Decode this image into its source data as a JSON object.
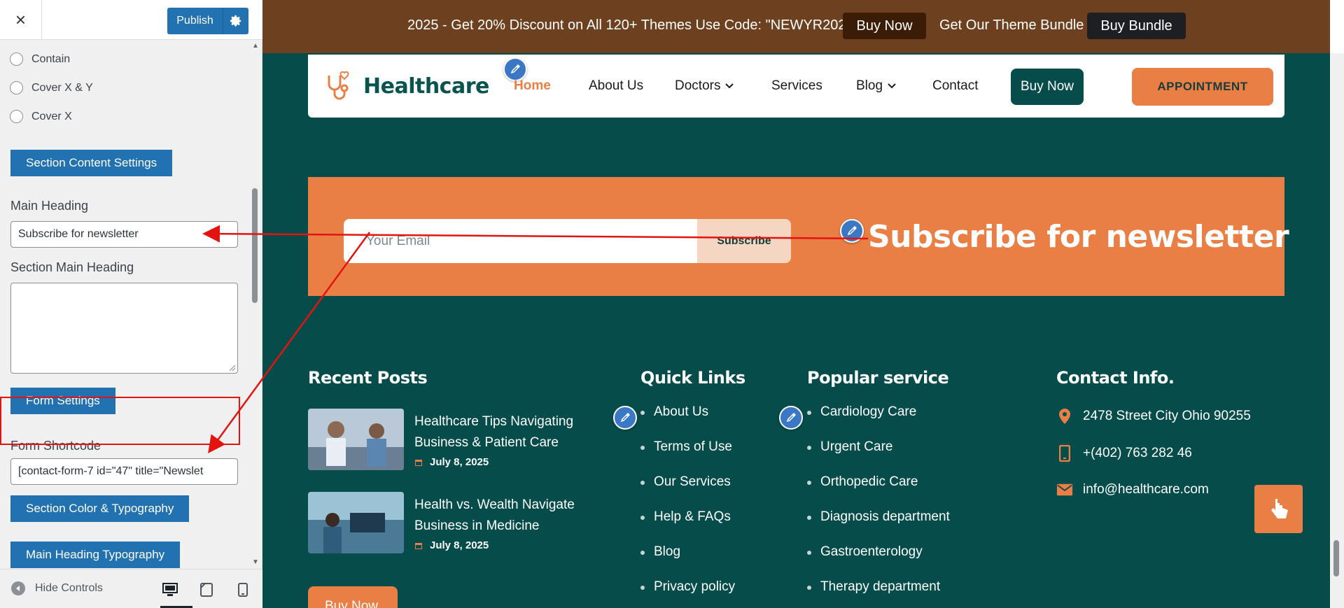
{
  "customizer": {
    "close_label": "×",
    "publish_label": "Publish",
    "radio_options": [
      "Contain",
      "Cover X & Y",
      "Cover X"
    ],
    "section_content_settings": "Section Content Settings",
    "main_heading_label": "Main Heading",
    "main_heading_value": "Subscribe for newsletter",
    "section_main_heading_label": "Section Main Heading",
    "section_main_heading_value": "",
    "form_settings": "Form Settings",
    "form_shortcode_label": "Form Shortcode",
    "form_shortcode_value": "[contact-form-7 id=\"47\" title=\"Newslet",
    "section_color_typography": "Section Color & Typography",
    "main_heading_typography": "Main Heading Typography",
    "hide_controls": "Hide Controls"
  },
  "promo": {
    "text": "2025 - Get 20% Discount on All 120+ Themes Use Code: \"NEWYR2025\"",
    "buy_now": "Buy Now",
    "bundle_text": "Get Our Theme Bundle",
    "buy_bundle": "Buy Bundle"
  },
  "nav": {
    "logo": "Healthcare",
    "items": [
      "Home",
      "About Us",
      "Doctors",
      "Services",
      "Blog",
      "Contact"
    ],
    "buy_now": "Buy Now",
    "appointment": "APPOINTMENT"
  },
  "newsletter": {
    "email_placeholder": "Your Email",
    "subscribe": "Subscribe",
    "heading": "Subscribe for newsletter"
  },
  "footer": {
    "recent_posts_heading": "Recent Posts",
    "posts": [
      {
        "title": "Healthcare Tips Navigating Business & Patient Care",
        "date": "July 8, 2025"
      },
      {
        "title": "Health vs. Wealth Navigate Business in Medicine",
        "date": "July 8, 2025"
      }
    ],
    "quick_links_heading": "Quick Links",
    "quick_links": [
      "About Us",
      "Terms of Use",
      "Our Services",
      "Help & FAQs",
      "Blog",
      "Privacy policy"
    ],
    "popular_heading": "Popular service",
    "popular": [
      "Cardiology Care",
      "Urgent Care",
      "Orthopedic Care",
      "Diagnosis department",
      "Gastroenterology",
      "Therapy department"
    ],
    "contact_heading": "Contact Info.",
    "address": "2478 Street City Ohio 90255",
    "phone": "+(402) 763 282 46",
    "email": "info@healthcare.com",
    "buy_now": "Buy Now"
  },
  "colors": {
    "wp_blue": "#2271b1",
    "brand_teal": "#054c4a",
    "brand_orange": "#ea7f45",
    "promo_brown": "#6d411f",
    "annotation_red": "#e3140f"
  }
}
